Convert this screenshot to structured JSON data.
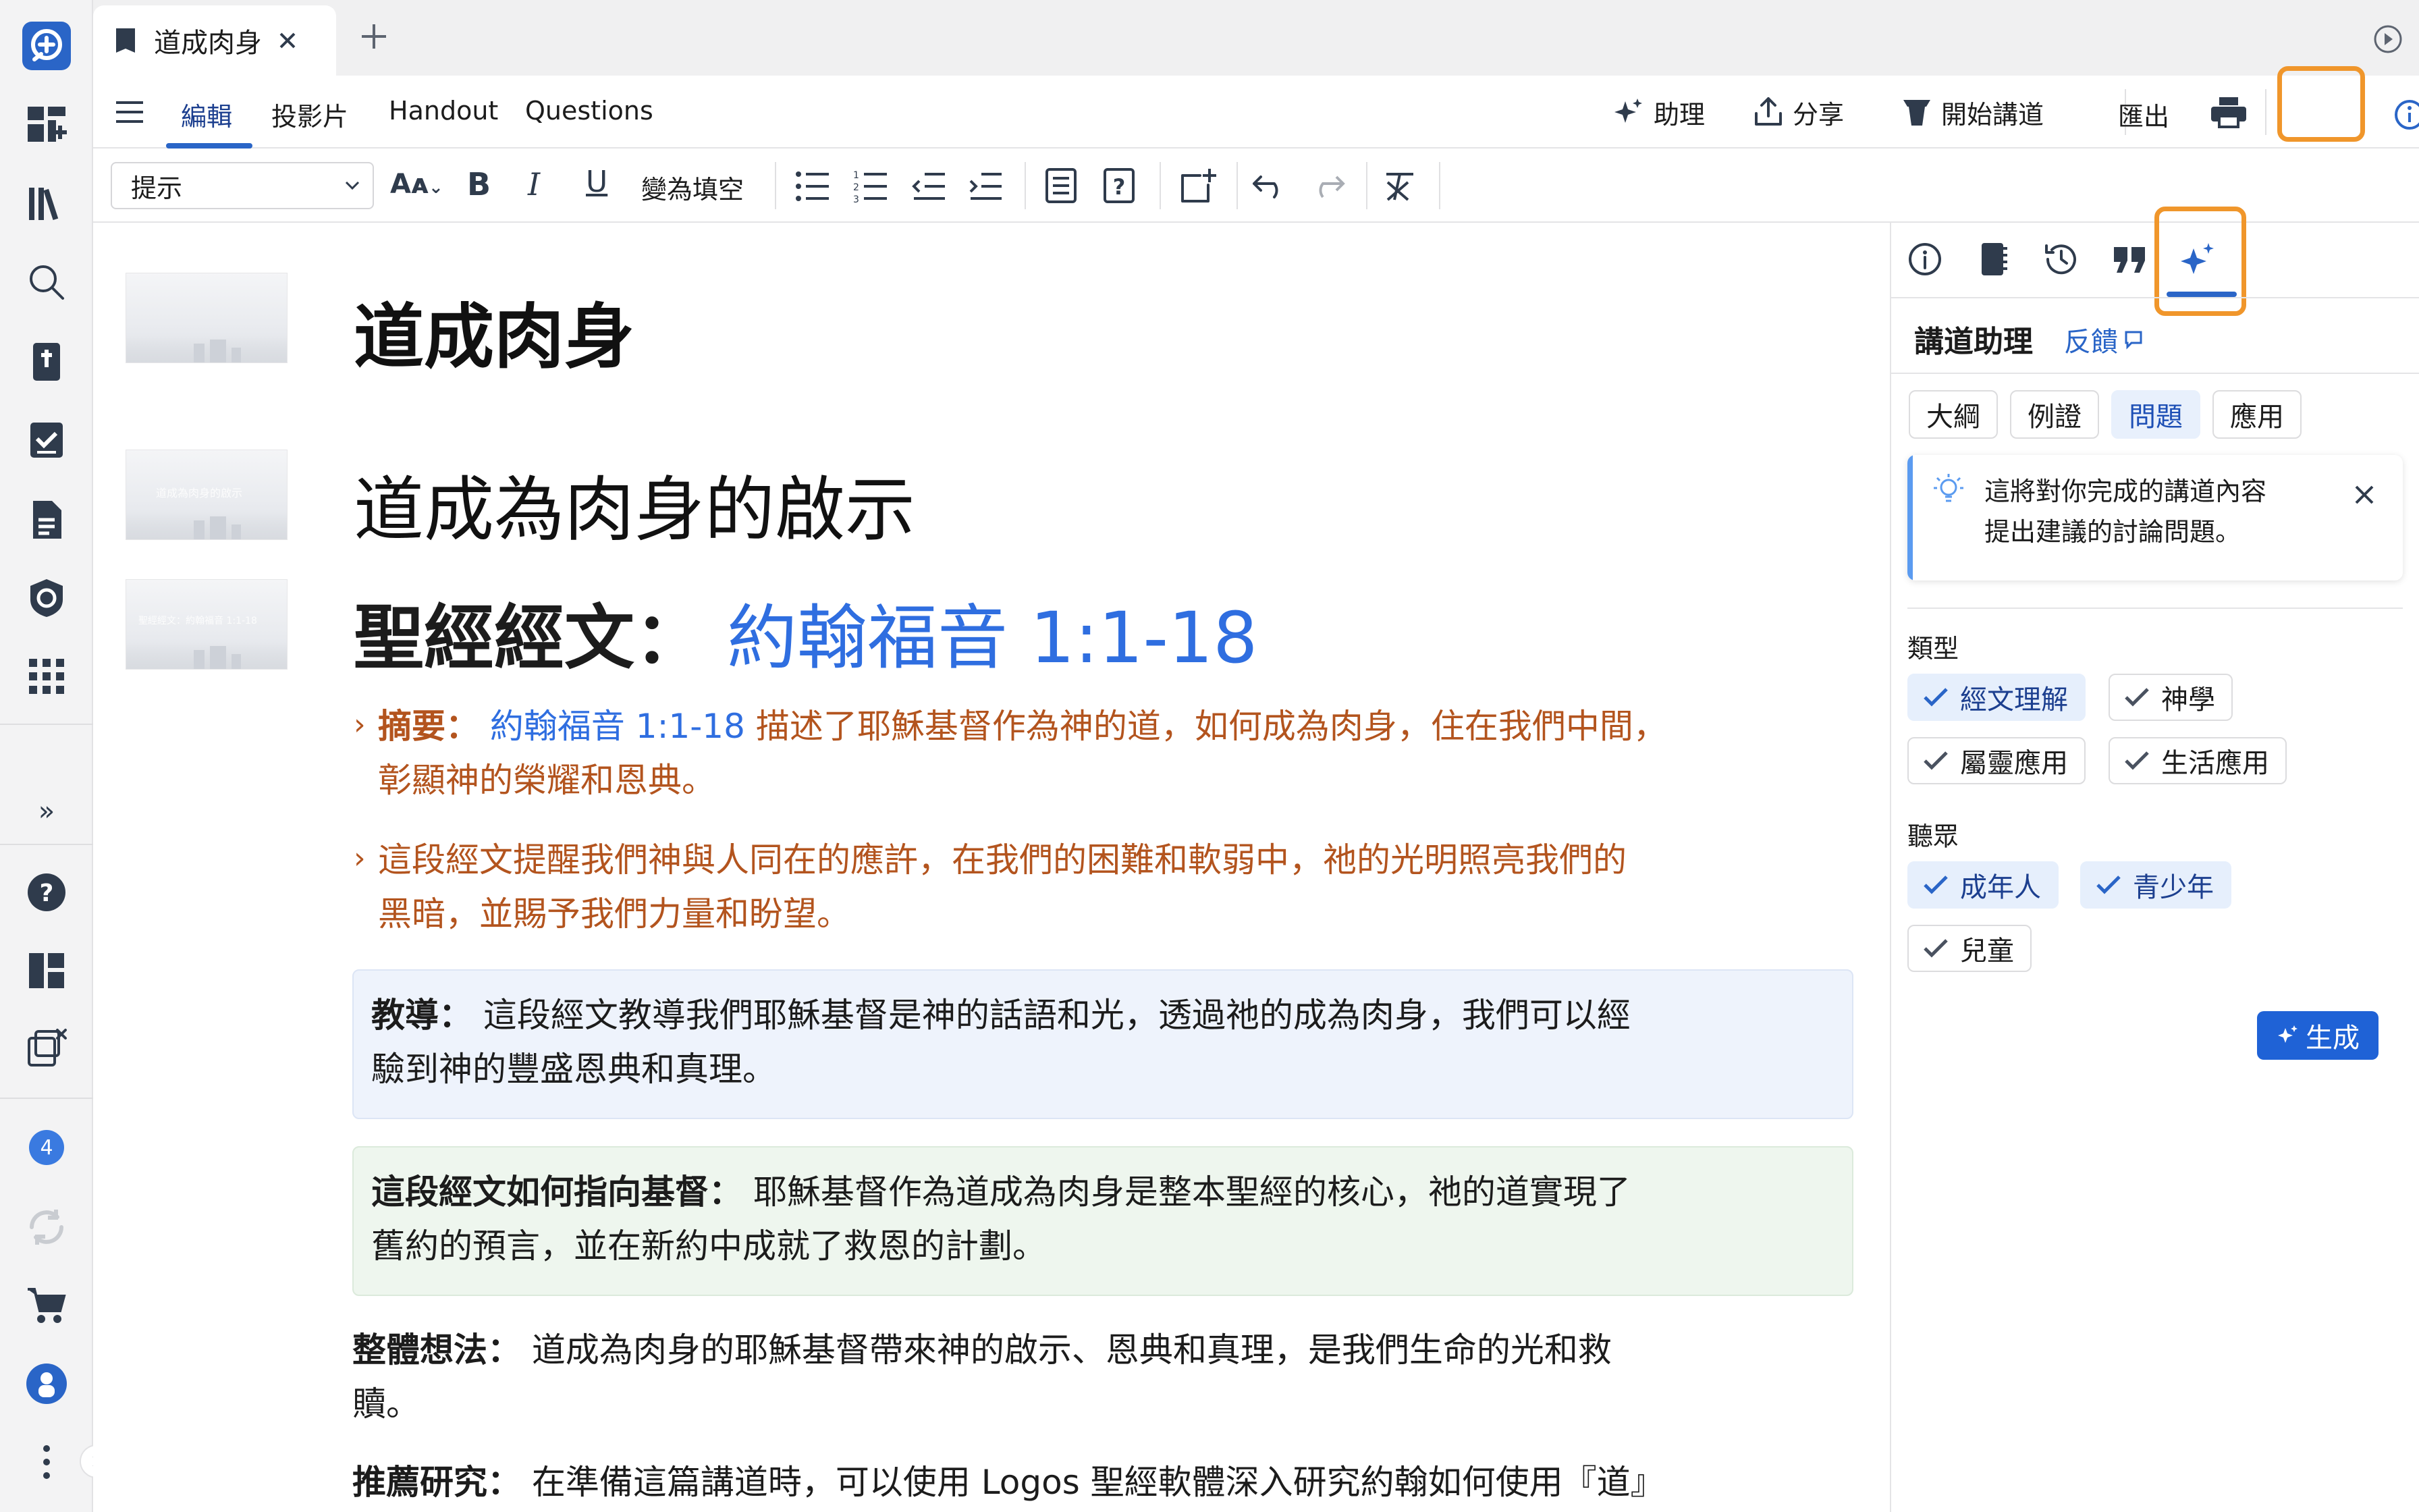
{
  "tab": {
    "title": "道成肉身"
  },
  "toolbar": {
    "edit": "編輯",
    "slides": "投影片",
    "handout": "Handout",
    "questions": "Questions",
    "assistant": "助理",
    "share": "分享",
    "start_preaching": "開始講道",
    "export": "匯出"
  },
  "format": {
    "style_select": "提示",
    "fill_blank": "變為填空"
  },
  "document": {
    "title": "道成肉身",
    "slide2_heading": "道成為肉身的啟示",
    "scripture_label": "聖經經文：",
    "scripture_ref": "約翰福音 1:1-18",
    "thumb2_text": "道成為肉身的啟示",
    "thumb3_text": "聖經經文：約翰福音 1:1-18",
    "summary_label": "摘要：",
    "summary_ref": "約翰福音 1:1-18",
    "summary_line1": "描述了耶穌基督作為神的道，如何成為肉身，住在我們中間，",
    "summary_line2": "彰顯神的榮耀和恩典。",
    "point2_line1": "這段經文提醒我們神與人同在的應許，在我們的困難和軟弱中，祂的光明照亮我們的",
    "point2_line2": "黑暗，並賜予我們力量和盼望。",
    "teaching_label": "教導：",
    "teaching_line1": "這段經文教導我們耶穌基督是神的話語和光，透過祂的成為肉身，我們可以經",
    "teaching_line2": "驗到神的豐盛恩典和真理。",
    "christ_label": "這段經文如何指向基督：",
    "christ_line1": "耶穌基督作為道成為肉身是整本聖經的核心，祂的道實現了",
    "christ_line2": "舊約的預言，並在新約中成就了救恩的計劃。",
    "overall_label": "整體想法：",
    "overall_line1": "道成為肉身的耶穌基督帶來神的啟示、恩典和真理，是我們生命的光和救",
    "overall_line2": "贖。",
    "research_label": "推薦研究：",
    "research_line1": "在準備這篇講道時，可以使用 Logos 聖經軟體深入研究約翰如何使用『道』"
  },
  "panel": {
    "title": "講道助理",
    "feedback": "反饋",
    "tabs": [
      "大綱",
      "例證",
      "問題",
      "應用"
    ],
    "selected_tab": "問題",
    "tip_line1": "這將對你完成的講道內容",
    "tip_line2": "提出建議的討論問題。",
    "type_label": "類型",
    "types": [
      "經文理解",
      "神學",
      "屬靈應用",
      "生活應用"
    ],
    "audience_label": "聽眾",
    "audiences": [
      "成年人",
      "青少年",
      "兒童"
    ],
    "generate": "生成"
  },
  "rail": {
    "badge_count": "4"
  },
  "colors": {
    "accent": "#2f6ee0",
    "highlight_ring": "#f0962b",
    "summary_text": "#b3541e"
  }
}
